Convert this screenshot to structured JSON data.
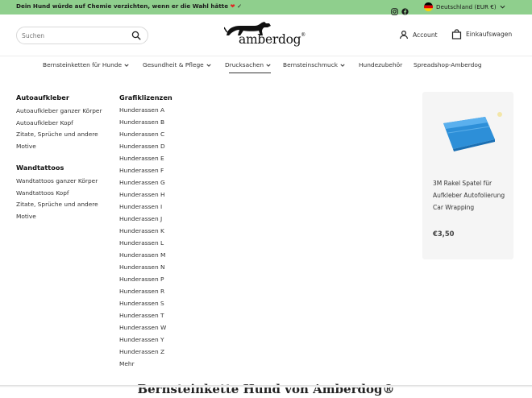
{
  "announcement": {
    "text": "Dein Hund würde auf Chemie verzichten, wenn er die Wahl hätte",
    "heart": "❤",
    "check": "✓"
  },
  "social": [
    {
      "icon": "instagram-icon"
    },
    {
      "icon": "facebook-icon"
    }
  ],
  "locale": {
    "label": "Deutschland (EUR €)",
    "flag_colors": [
      "#000000",
      "#dd0000",
      "#ffce00"
    ]
  },
  "search": {
    "placeholder": "Suchen"
  },
  "logo": {
    "text": "amberdog",
    "reg": "®"
  },
  "header_actions": {
    "account": "Account",
    "cart": "Einkaufswagen"
  },
  "nav": {
    "items": [
      {
        "label": "Bernsteinketten für Hunde",
        "has_dropdown": true
      },
      {
        "label": "Gesundheit & Pflege",
        "has_dropdown": true
      },
      {
        "label": "Drucksachen",
        "has_dropdown": true,
        "active": true
      },
      {
        "label": "Bernsteinschmuck",
        "has_dropdown": true
      },
      {
        "label": "Hundezubehör",
        "has_dropdown": false
      },
      {
        "label": "Spreadshop-Amberdog",
        "has_dropdown": false
      }
    ]
  },
  "menu": {
    "col1": {
      "sections": [
        {
          "heading": "Autoaufkleber",
          "links": [
            "Autoaufkleber ganzer Körper",
            "Autoaufkleber Kopf",
            "Zitate, Sprüche und andere Motive"
          ]
        },
        {
          "heading": "Wandtattoos",
          "links": [
            "Wandtattoos ganzer Körper",
            "Wandtattoos Kopf",
            "Zitate, Sprüche und andere Motive"
          ]
        }
      ]
    },
    "col2": {
      "heading": "Grafiklizenzen",
      "links": [
        "Hunderassen A",
        "Hunderassen B",
        "Hunderassen C",
        "Hunderassen D",
        "Hunderassen E",
        "Hunderassen F",
        "Hunderassen G",
        "Hunderassen H",
        "Hunderassen I",
        "Hunderassen J",
        "Hunderassen K",
        "Hunderassen L",
        "Hunderassen M",
        "Hunderassen N",
        "Hunderassen P",
        "Hunderassen R",
        "Hunderassen S",
        "Hunderassen T",
        "Hunderassen W",
        "Hunderassen Y",
        "Hunderassen Z",
        "Mehr"
      ]
    }
  },
  "featured_product": {
    "name": "3M Rakel Spatel für Aufkleber Autofolierung Car Wrapping",
    "price": "€3,50",
    "image_color": "#2d8fd8"
  },
  "page_heading": "Bernsteinkette Hund von Amberdog®",
  "colors": {
    "announcement_bg": "#8fcf8d",
    "card_bg": "#f5f5f5"
  }
}
